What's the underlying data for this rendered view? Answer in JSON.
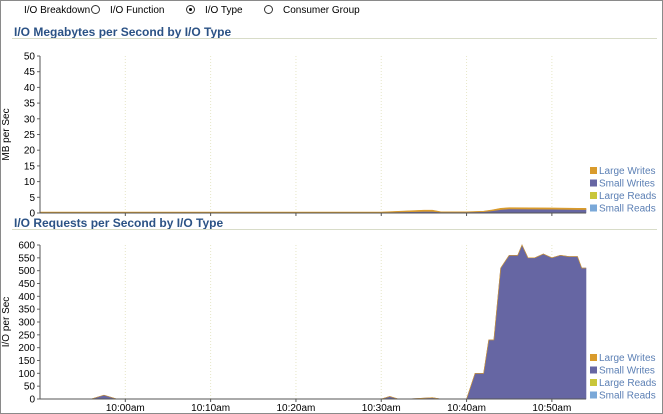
{
  "controls": {
    "breakdown_label": "I/O Breakdown",
    "options": [
      {
        "label": "I/O Function",
        "checked": false
      },
      {
        "label": "I/O Type",
        "checked": true
      },
      {
        "label": "Consumer Group",
        "checked": false
      }
    ]
  },
  "colors": {
    "large_writes": "#d99b2c",
    "small_writes": "#6666a3",
    "large_reads": "#c9c63a",
    "small_reads": "#7aa8d8",
    "title": "#2b5285"
  },
  "legend": [
    "Large Writes",
    "Small Writes",
    "Large Reads",
    "Small Reads"
  ],
  "chart_data": [
    {
      "type": "area",
      "title": "I/O Megabytes per Second by I/O Type",
      "ylabel": "MB per Sec",
      "ylim": [
        0,
        50
      ],
      "yticks": [
        "0",
        "5",
        "10",
        "15",
        "20",
        "25",
        "30",
        "35",
        "40",
        "45",
        "50"
      ],
      "x_ticks": [
        "10:00am",
        "10:10am",
        "10:20am",
        "10:30am",
        "10:40am",
        "10:50am"
      ],
      "x_tick_minutes": [
        600,
        610,
        620,
        630,
        640,
        650
      ],
      "x_range_minutes": [
        590,
        654
      ],
      "series": [
        {
          "name": "Small Writes",
          "x": [
            590,
            610,
            630,
            635,
            636,
            637,
            640,
            642,
            643,
            644,
            645,
            650,
            653,
            654
          ],
          "y": [
            0.2,
            0.2,
            0.2,
            0.5,
            0.5,
            0.3,
            0.3,
            0.4,
            0.7,
            1.1,
            1.3,
            1.2,
            1.1,
            1.1
          ]
        },
        {
          "name": "Large Writes",
          "x": [
            590,
            610,
            630,
            635,
            636,
            637,
            640,
            642,
            643,
            644,
            645,
            650,
            653,
            654
          ],
          "y": [
            0.1,
            0.1,
            0.1,
            0.4,
            0.4,
            0.1,
            0.1,
            0.2,
            0.3,
            0.4,
            0.4,
            0.4,
            0.4,
            0.4
          ]
        }
      ]
    },
    {
      "type": "area",
      "title": "I/O Requests per Second by I/O Type",
      "ylabel": "I/O per Sec",
      "ylim": [
        0,
        600
      ],
      "yticks": [
        "0",
        "50",
        "100",
        "150",
        "200",
        "250",
        "300",
        "350",
        "400",
        "450",
        "500",
        "550",
        "600"
      ],
      "x_ticks": [
        "10:00am",
        "10:10am",
        "10:20am",
        "10:30am",
        "10:40am",
        "10:50am"
      ],
      "x_tick_minutes": [
        600,
        610,
        620,
        630,
        640,
        650
      ],
      "x_range_minutes": [
        590,
        654
      ],
      "series": [
        {
          "name": "Small Writes",
          "x": [
            590,
            596,
            597.5,
            599,
            630,
            631,
            632,
            633,
            636,
            637,
            638,
            640,
            641,
            642,
            642.6,
            643.2,
            644,
            645,
            646,
            646.5,
            647.2,
            648,
            649,
            650,
            651,
            652,
            653,
            653.5,
            654
          ],
          "y": [
            0,
            0,
            15,
            0,
            0,
            10,
            0,
            0,
            5,
            0,
            0,
            0,
            100,
            100,
            230,
            230,
            510,
            560,
            560,
            600,
            550,
            550,
            565,
            550,
            560,
            555,
            555,
            510,
            510
          ]
        },
        {
          "name": "Large Writes",
          "x": [
            590,
            654
          ],
          "y": [
            0,
            0
          ]
        }
      ]
    }
  ]
}
